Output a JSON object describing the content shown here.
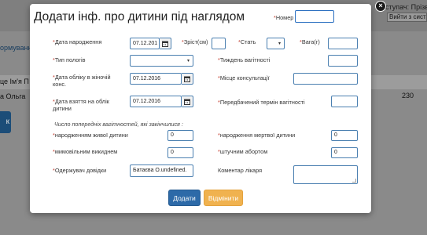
{
  "background": {
    "user_label": "ступач: Прізв",
    "user_button": "Вийти з систем",
    "form_link": "ормуванн",
    "table_header_fragment": "це Ім'я П",
    "row_name_fragment": "а Ольга",
    "row_value_fragment": "230",
    "button_fragment": "к"
  },
  "modal": {
    "title": "Додати інф. про дитини під наглядом",
    "close_glyph": "×",
    "number_label": "Номер",
    "number_value": "",
    "fields": {
      "birth_date": {
        "label": "Дата народження",
        "value": "07.12.201"
      },
      "height": {
        "label": "Зріст(см)",
        "value": ""
      },
      "sex": {
        "label": "Стать",
        "value": ""
      },
      "weight": {
        "label": "Вага(г)",
        "value": ""
      },
      "birth_type": {
        "label": "Тип пологів",
        "value": ""
      },
      "pregnancy_week": {
        "label": "Тиждень вагітності",
        "value": ""
      },
      "registration_date": {
        "label": "Дата обліку в жіночій конс.",
        "value": "07.12.2016"
      },
      "consultation_place": {
        "label": "Місце консультації",
        "value": ""
      },
      "registration_taken_date": {
        "label": "Дата взяття на облік дитини",
        "value": "07.12.2016"
      },
      "expected_term": {
        "label": "Передбачений термін вагітності",
        "value": ""
      },
      "live_births": {
        "label": "народженням живої дитини",
        "value": "0"
      },
      "stillbirths": {
        "label": "народження мертвої дитини",
        "value": "0"
      },
      "miscarriages": {
        "label": "мимовільним викиднем",
        "value": "0"
      },
      "abortions": {
        "label": "штучним абортом",
        "value": "0"
      },
      "recipient": {
        "label": "Одержувач довідки",
        "value": "Батаєва О.undefined."
      },
      "doctor_comment": {
        "label": "Коментар лікаря",
        "value": ""
      }
    },
    "previous_pregnancies_note": "Число попередніх вагітностей, які закінчилися :",
    "buttons": {
      "add": "Додати",
      "cancel": "Відмінити"
    }
  }
}
